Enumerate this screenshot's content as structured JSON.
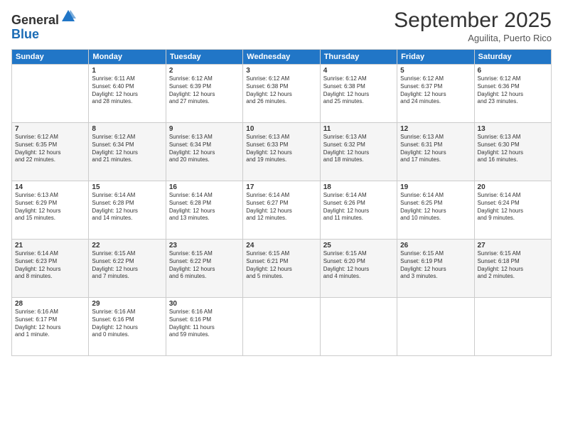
{
  "logo": {
    "general": "General",
    "blue": "Blue"
  },
  "title": "September 2025",
  "location": "Aguilita, Puerto Rico",
  "weekdays": [
    "Sunday",
    "Monday",
    "Tuesday",
    "Wednesday",
    "Thursday",
    "Friday",
    "Saturday"
  ],
  "weeks": [
    [
      {
        "day": "",
        "info": ""
      },
      {
        "day": "1",
        "info": "Sunrise: 6:11 AM\nSunset: 6:40 PM\nDaylight: 12 hours\nand 28 minutes."
      },
      {
        "day": "2",
        "info": "Sunrise: 6:12 AM\nSunset: 6:39 PM\nDaylight: 12 hours\nand 27 minutes."
      },
      {
        "day": "3",
        "info": "Sunrise: 6:12 AM\nSunset: 6:38 PM\nDaylight: 12 hours\nand 26 minutes."
      },
      {
        "day": "4",
        "info": "Sunrise: 6:12 AM\nSunset: 6:38 PM\nDaylight: 12 hours\nand 25 minutes."
      },
      {
        "day": "5",
        "info": "Sunrise: 6:12 AM\nSunset: 6:37 PM\nDaylight: 12 hours\nand 24 minutes."
      },
      {
        "day": "6",
        "info": "Sunrise: 6:12 AM\nSunset: 6:36 PM\nDaylight: 12 hours\nand 23 minutes."
      }
    ],
    [
      {
        "day": "7",
        "info": "Sunrise: 6:12 AM\nSunset: 6:35 PM\nDaylight: 12 hours\nand 22 minutes."
      },
      {
        "day": "8",
        "info": "Sunrise: 6:12 AM\nSunset: 6:34 PM\nDaylight: 12 hours\nand 21 minutes."
      },
      {
        "day": "9",
        "info": "Sunrise: 6:13 AM\nSunset: 6:34 PM\nDaylight: 12 hours\nand 20 minutes."
      },
      {
        "day": "10",
        "info": "Sunrise: 6:13 AM\nSunset: 6:33 PM\nDaylight: 12 hours\nand 19 minutes."
      },
      {
        "day": "11",
        "info": "Sunrise: 6:13 AM\nSunset: 6:32 PM\nDaylight: 12 hours\nand 18 minutes."
      },
      {
        "day": "12",
        "info": "Sunrise: 6:13 AM\nSunset: 6:31 PM\nDaylight: 12 hours\nand 17 minutes."
      },
      {
        "day": "13",
        "info": "Sunrise: 6:13 AM\nSunset: 6:30 PM\nDaylight: 12 hours\nand 16 minutes."
      }
    ],
    [
      {
        "day": "14",
        "info": "Sunrise: 6:13 AM\nSunset: 6:29 PM\nDaylight: 12 hours\nand 15 minutes."
      },
      {
        "day": "15",
        "info": "Sunrise: 6:14 AM\nSunset: 6:28 PM\nDaylight: 12 hours\nand 14 minutes."
      },
      {
        "day": "16",
        "info": "Sunrise: 6:14 AM\nSunset: 6:28 PM\nDaylight: 12 hours\nand 13 minutes."
      },
      {
        "day": "17",
        "info": "Sunrise: 6:14 AM\nSunset: 6:27 PM\nDaylight: 12 hours\nand 12 minutes."
      },
      {
        "day": "18",
        "info": "Sunrise: 6:14 AM\nSunset: 6:26 PM\nDaylight: 12 hours\nand 11 minutes."
      },
      {
        "day": "19",
        "info": "Sunrise: 6:14 AM\nSunset: 6:25 PM\nDaylight: 12 hours\nand 10 minutes."
      },
      {
        "day": "20",
        "info": "Sunrise: 6:14 AM\nSunset: 6:24 PM\nDaylight: 12 hours\nand 9 minutes."
      }
    ],
    [
      {
        "day": "21",
        "info": "Sunrise: 6:14 AM\nSunset: 6:23 PM\nDaylight: 12 hours\nand 8 minutes."
      },
      {
        "day": "22",
        "info": "Sunrise: 6:15 AM\nSunset: 6:22 PM\nDaylight: 12 hours\nand 7 minutes."
      },
      {
        "day": "23",
        "info": "Sunrise: 6:15 AM\nSunset: 6:22 PM\nDaylight: 12 hours\nand 6 minutes."
      },
      {
        "day": "24",
        "info": "Sunrise: 6:15 AM\nSunset: 6:21 PM\nDaylight: 12 hours\nand 5 minutes."
      },
      {
        "day": "25",
        "info": "Sunrise: 6:15 AM\nSunset: 6:20 PM\nDaylight: 12 hours\nand 4 minutes."
      },
      {
        "day": "26",
        "info": "Sunrise: 6:15 AM\nSunset: 6:19 PM\nDaylight: 12 hours\nand 3 minutes."
      },
      {
        "day": "27",
        "info": "Sunrise: 6:15 AM\nSunset: 6:18 PM\nDaylight: 12 hours\nand 2 minutes."
      }
    ],
    [
      {
        "day": "28",
        "info": "Sunrise: 6:16 AM\nSunset: 6:17 PM\nDaylight: 12 hours\nand 1 minute."
      },
      {
        "day": "29",
        "info": "Sunrise: 6:16 AM\nSunset: 6:16 PM\nDaylight: 12 hours\nand 0 minutes."
      },
      {
        "day": "30",
        "info": "Sunrise: 6:16 AM\nSunset: 6:16 PM\nDaylight: 11 hours\nand 59 minutes."
      },
      {
        "day": "",
        "info": ""
      },
      {
        "day": "",
        "info": ""
      },
      {
        "day": "",
        "info": ""
      },
      {
        "day": "",
        "info": ""
      }
    ]
  ]
}
